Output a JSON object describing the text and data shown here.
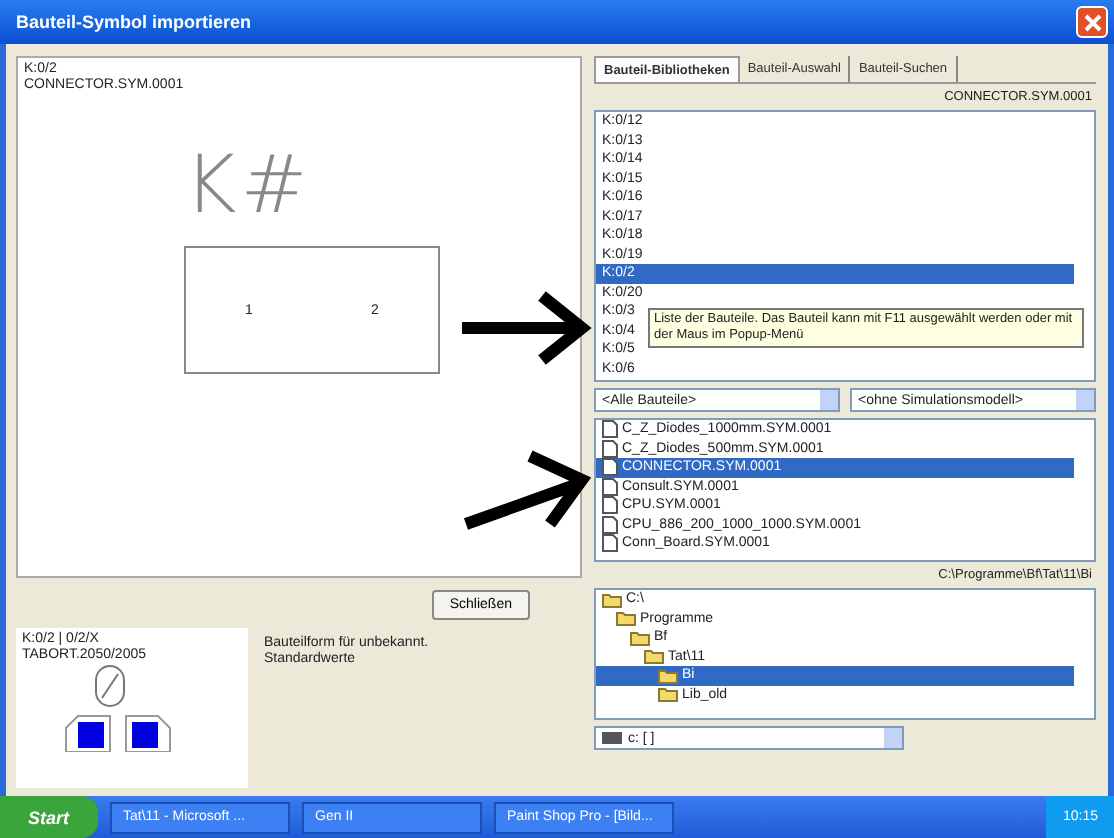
{
  "window": {
    "title": "Bauteil-Symbol importieren"
  },
  "preview": {
    "lines": [
      "K:0/2",
      "CONNECTOR.SYM.0001"
    ],
    "symbol": "K#",
    "pins": [
      "1",
      "2"
    ]
  },
  "close_button": "Schließen",
  "info": {
    "lines": [
      "K:0/2 | 0/2/X",
      "TABORT.2050/2005"
    ]
  },
  "message": [
    "Bauteilform für unbekannt.",
    "Standardwerte"
  ],
  "tabs": [
    {
      "label": "Bauteil-Bibliotheken",
      "selected": true
    },
    {
      "label": "Bauteil-Auswahl",
      "selected": false
    },
    {
      "label": "Bauteil-Suchen",
      "selected": false
    }
  ],
  "library_name": "CONNECTOR.SYM.0001",
  "parts": [
    {
      "name": "K:0/12",
      "selected": false
    },
    {
      "name": "K:0/13",
      "selected": false
    },
    {
      "name": "K:0/14",
      "selected": false
    },
    {
      "name": "K:0/15",
      "selected": false
    },
    {
      "name": "K:0/16",
      "selected": false
    },
    {
      "name": "K:0/17",
      "selected": false
    },
    {
      "name": "K:0/18",
      "selected": false
    },
    {
      "name": "K:0/19",
      "selected": false
    },
    {
      "name": "K:0/2",
      "selected": true
    },
    {
      "name": "K:0/20",
      "selected": false
    },
    {
      "name": "K:0/3",
      "selected": false
    },
    {
      "name": "K:0/4",
      "selected": false
    },
    {
      "name": "K:0/5",
      "selected": false
    },
    {
      "name": "K:0/6",
      "selected": false
    }
  ],
  "tooltip": "Liste der Bauteile. Das Bauteil kann mit F11 ausgewählt werden oder mit der Maus im Popup-Menü",
  "filters": [
    "<Alle Bauteile>",
    "<ohne Simulationsmodell>"
  ],
  "files": [
    {
      "name": "C_Z_Diodes_1000mm.SYM.0001",
      "selected": false
    },
    {
      "name": "C_Z_Diodes_500mm.SYM.0001",
      "selected": false
    },
    {
      "name": "CONNECTOR.SYM.0001",
      "selected": true
    },
    {
      "name": "Consult.SYM.0001",
      "selected": false
    },
    {
      "name": "CPU.SYM.0001",
      "selected": false
    },
    {
      "name": "CPU_886_200_1000_1000.SYM.0001",
      "selected": false
    },
    {
      "name": "Conn_Board.SYM.0001",
      "selected": false
    }
  ],
  "path": "C:\\Programme\\Bf\\Tat\\11\\Bi",
  "folders": [
    {
      "name": "C:\\",
      "selected": false,
      "children": [
        {
          "name": "Programme",
          "selected": false,
          "children": [
            {
              "name": "Bf",
              "selected": false,
              "children": [
                {
                  "name": "Tat\\11",
                  "selected": false,
                  "children": [
                    {
                      "name": "Bi",
                      "selected": true
                    },
                    {
                      "name": "Lib_old",
                      "selected": false
                    }
                  ]
                }
              ]
            }
          ]
        }
      ]
    }
  ],
  "drive": "c: [ ]",
  "taskbar": {
    "start": "Start",
    "tasks": [
      "Tat\\11 - Microsoft ...",
      "Gen II",
      "Paint Shop Pro - [Bild..."
    ],
    "clock": "10:15"
  }
}
